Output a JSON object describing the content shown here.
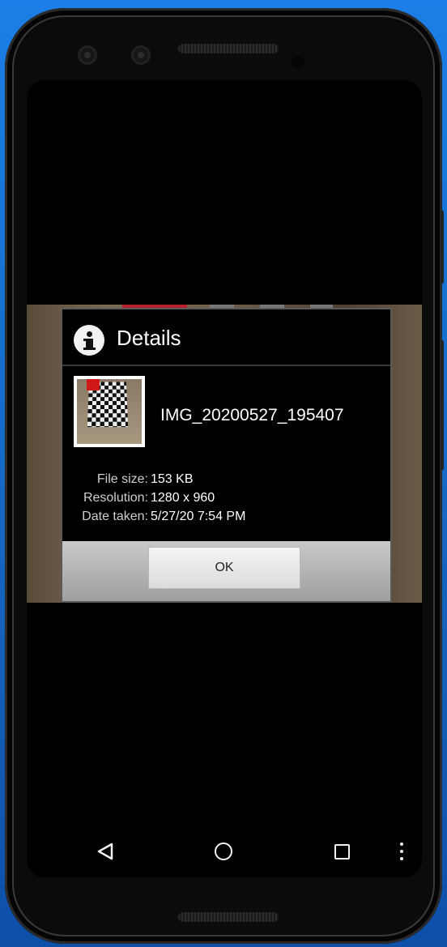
{
  "dialog": {
    "title": "Details",
    "icon": "info-icon",
    "filename": "IMG_20200527_195407",
    "thumbnail_icon": "image-thumbnail",
    "rows": [
      {
        "label": "File size:",
        "value": "153 KB"
      },
      {
        "label": "Resolution:",
        "value": "1280 x 960"
      },
      {
        "label": "Date taken:",
        "value": "5/27/20 7:54 PM"
      }
    ],
    "ok_label": "OK"
  },
  "navbar": {
    "back_icon": "back-triangle-icon",
    "home_icon": "home-circle-icon",
    "recents_icon": "recents-square-icon",
    "more_icon": "more-vertical-icon"
  },
  "colors": {
    "desktop_bg": "#1565c0",
    "dialog_bg": "#000000",
    "button_bar": "#b0b0b0",
    "accent_red": "#b5202a"
  }
}
